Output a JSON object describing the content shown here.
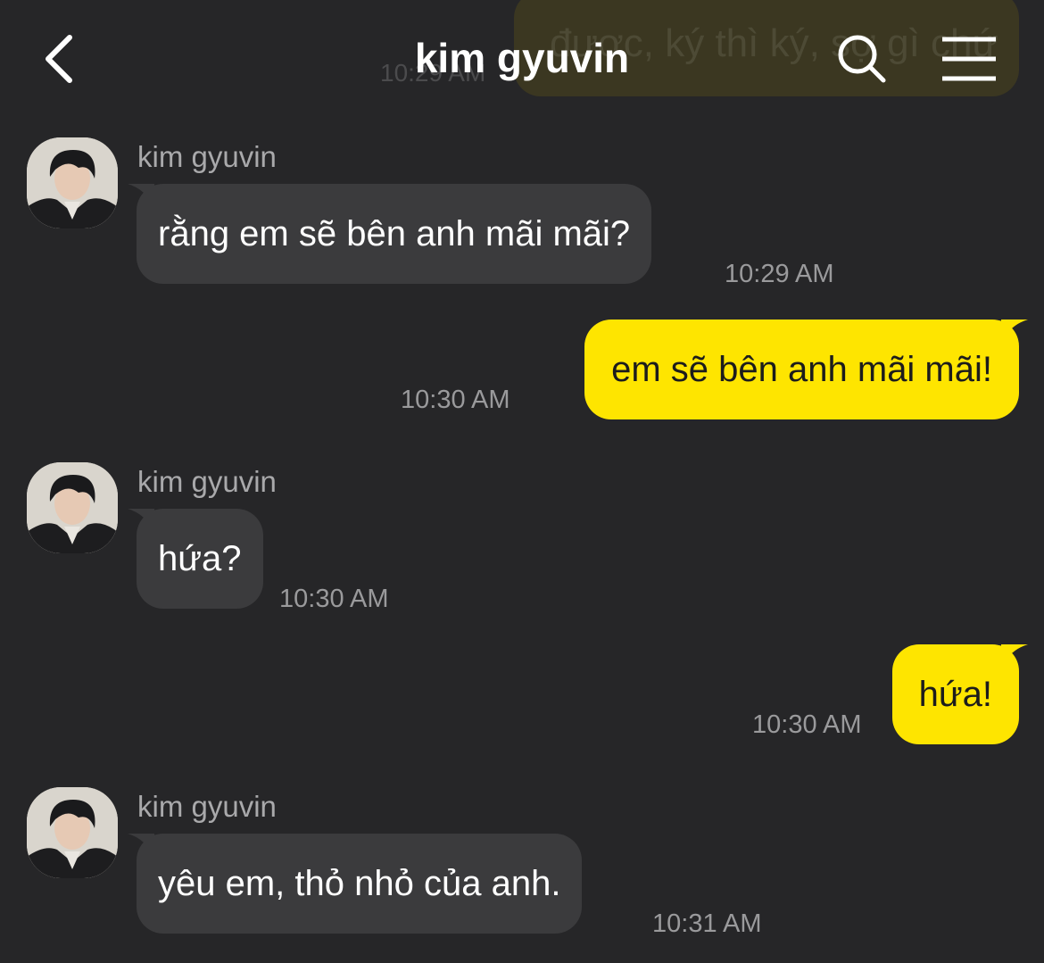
{
  "header": {
    "title": "kim gyuvin",
    "back_icon": "chevron-left-icon",
    "search_icon": "search-icon",
    "menu_icon": "menu-icon"
  },
  "ghost": {
    "text": "được, ký thì ký, sợ gì chứ",
    "time": "10:29 AM"
  },
  "colors": {
    "background": "#262628",
    "incoming_bubble": "#3b3b3d",
    "outgoing_bubble": "#fee500",
    "timestamp": "#9a9a9c"
  },
  "messages": [
    {
      "direction": "in",
      "sender": "kim gyuvin",
      "text": "rằng em sẽ bên anh mãi mãi?",
      "time": "10:29 AM"
    },
    {
      "direction": "out",
      "text": "em sẽ bên anh mãi mãi!",
      "time": "10:30 AM"
    },
    {
      "direction": "in",
      "sender": "kim gyuvin",
      "text": "hứa?",
      "time": "10:30 AM"
    },
    {
      "direction": "out",
      "text": "hứa!",
      "time": "10:30 AM"
    },
    {
      "direction": "in",
      "sender": "kim gyuvin",
      "text": "yêu em, thỏ nhỏ của anh.",
      "time": "10:31 AM"
    }
  ]
}
